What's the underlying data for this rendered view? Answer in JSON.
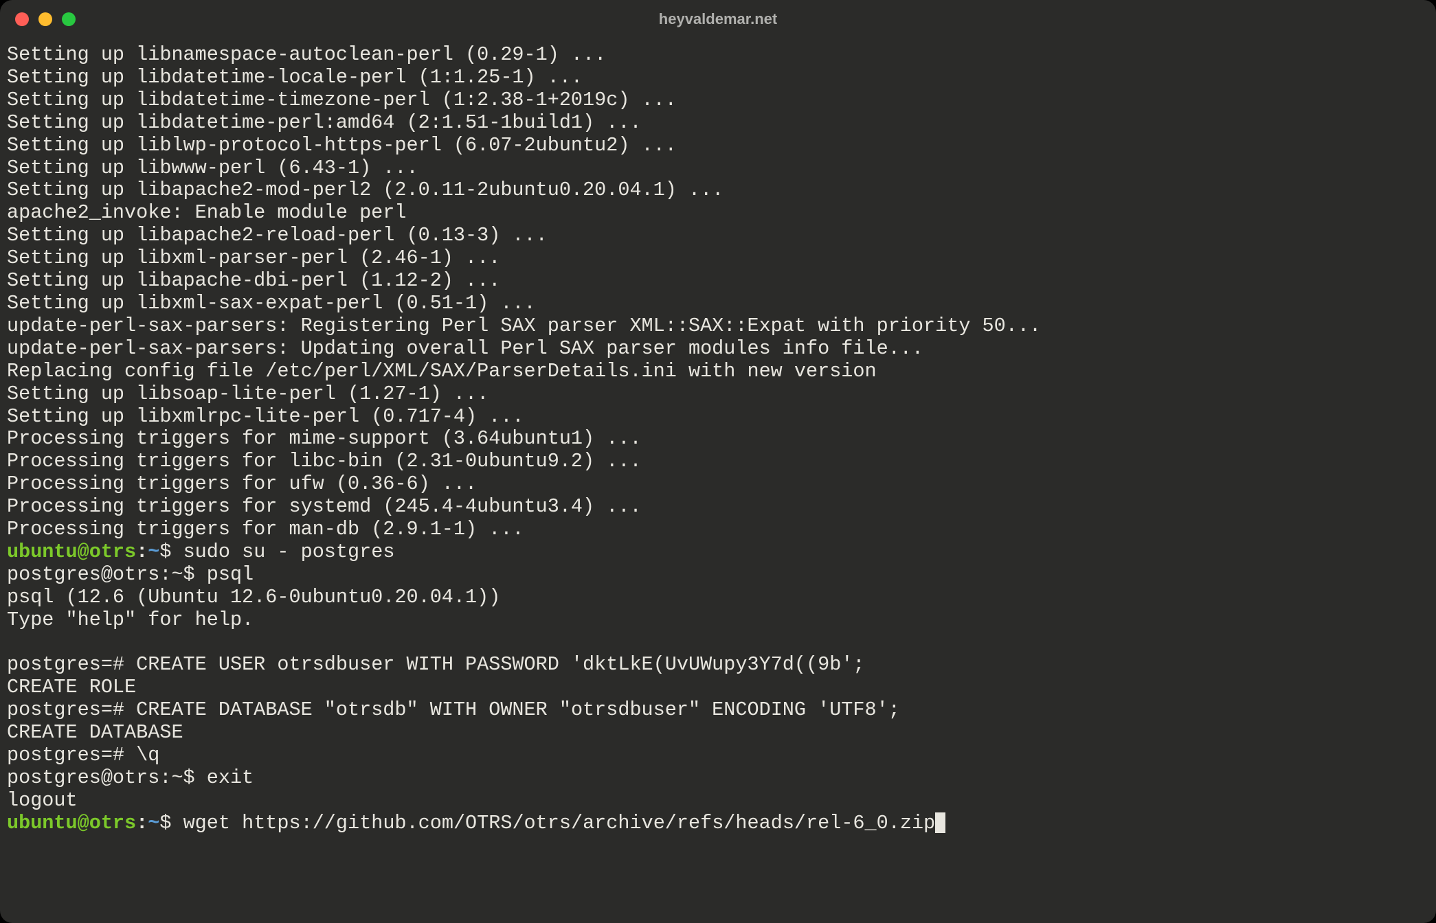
{
  "window": {
    "title": "heyvaldemar.net"
  },
  "colors": {
    "bg": "#2b2b29",
    "fg": "#e8e6df",
    "promptUser": "#7cc92a",
    "promptPath": "#5a9bd4",
    "trafficRed": "#ff5f57",
    "trafficYellow": "#febc2e",
    "trafficGreen": "#28c840"
  },
  "output": [
    "Setting up libnamespace-autoclean-perl (0.29-1) ...",
    "Setting up libdatetime-locale-perl (1:1.25-1) ...",
    "Setting up libdatetime-timezone-perl (1:2.38-1+2019c) ...",
    "Setting up libdatetime-perl:amd64 (2:1.51-1build1) ...",
    "Setting up liblwp-protocol-https-perl (6.07-2ubuntu2) ...",
    "Setting up libwww-perl (6.43-1) ...",
    "Setting up libapache2-mod-perl2 (2.0.11-2ubuntu0.20.04.1) ...",
    "apache2_invoke: Enable module perl",
    "Setting up libapache2-reload-perl (0.13-3) ...",
    "Setting up libxml-parser-perl (2.46-1) ...",
    "Setting up libapache-dbi-perl (1.12-2) ...",
    "Setting up libxml-sax-expat-perl (0.51-1) ...",
    "update-perl-sax-parsers: Registering Perl SAX parser XML::SAX::Expat with priority 50...",
    "update-perl-sax-parsers: Updating overall Perl SAX parser modules info file...",
    "Replacing config file /etc/perl/XML/SAX/ParserDetails.ini with new version",
    "Setting up libsoap-lite-perl (1.27-1) ...",
    "Setting up libxmlrpc-lite-perl (0.717-4) ...",
    "Processing triggers for mime-support (3.64ubuntu1) ...",
    "Processing triggers for libc-bin (2.31-0ubuntu9.2) ...",
    "Processing triggers for ufw (0.36-6) ...",
    "Processing triggers for systemd (245.4-4ubuntu3.4) ...",
    "Processing triggers for man-db (2.9.1-1) ..."
  ],
  "prompts": {
    "ubuntu": {
      "user": "ubuntu@otrs",
      "path": "~",
      "sep": ":",
      "dollar": "$ "
    },
    "postgresShell": {
      "plain": "postgres@otrs:~$ "
    },
    "psql": {
      "plain": "postgres=# "
    }
  },
  "session": {
    "cmd_sudo": "sudo su - postgres",
    "cmd_psql": "psql",
    "psql_banner1": "psql (12.6 (Ubuntu 12.6-0ubuntu0.20.04.1))",
    "psql_banner2": "Type \"help\" for help.",
    "blank": "",
    "sql_create_user": "CREATE USER otrsdbuser WITH PASSWORD 'dktLkE(UvUWupy3Y7d((9b';",
    "resp_create_role": "CREATE ROLE",
    "sql_create_db": "CREATE DATABASE \"otrsdb\" WITH OWNER \"otrsdbuser\" ENCODING 'UTF8';",
    "resp_create_db": "CREATE DATABASE",
    "sql_quit": "\\q",
    "cmd_exit": "exit",
    "logout": "logout",
    "cmd_wget": "wget https://github.com/OTRS/otrs/archive/refs/heads/rel-6_0.zip"
  }
}
